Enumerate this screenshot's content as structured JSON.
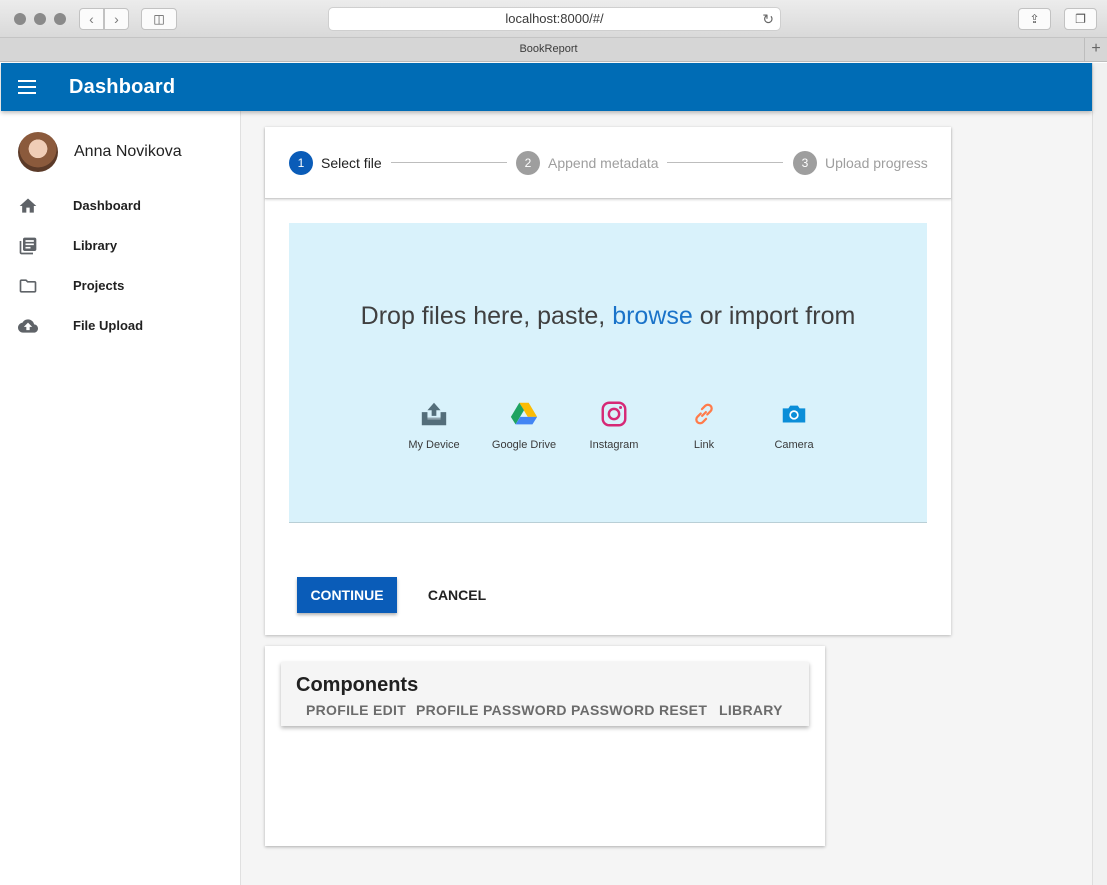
{
  "browser": {
    "url": "localhost:8000/#/",
    "tab_title": "BookReport"
  },
  "appbar": {
    "title": "Dashboard"
  },
  "sidebar": {
    "user_name": "Anna Novikova",
    "items": [
      {
        "label": "Dashboard",
        "icon": "home-icon"
      },
      {
        "label": "Library",
        "icon": "library-icon"
      },
      {
        "label": "Projects",
        "icon": "folder-icon"
      },
      {
        "label": "File Upload",
        "icon": "cloud-upload-icon"
      }
    ]
  },
  "stepper": {
    "steps": [
      {
        "number": "1",
        "label": "Select file",
        "active": true
      },
      {
        "number": "2",
        "label": "Append metadata",
        "active": false
      },
      {
        "number": "3",
        "label": "Upload progress",
        "active": false
      }
    ]
  },
  "dropzone": {
    "text_before": "Drop files here, paste, ",
    "browse": "browse",
    "text_after": " or import from",
    "sources": [
      {
        "label": "My Device",
        "icon": "device-upload-icon"
      },
      {
        "label": "Google Drive",
        "icon": "google-drive-icon"
      },
      {
        "label": "Instagram",
        "icon": "instagram-icon"
      },
      {
        "label": "Link",
        "icon": "link-icon"
      },
      {
        "label": "Camera",
        "icon": "camera-icon"
      }
    ]
  },
  "actions": {
    "continue": "CONTINUE",
    "cancel": "CANCEL"
  },
  "components": {
    "title": "Components",
    "tabs": [
      "PROFILE EDIT",
      "PROFILE PASSWORD",
      "PASSWORD RESET",
      "LIBRARY"
    ]
  },
  "colors": {
    "appbar": "#006cb5",
    "step_active": "#0a5cb8",
    "step_inactive": "#9e9e9e",
    "dropzone_bg": "#d9f2fb",
    "browse_link": "#1a73c9"
  }
}
